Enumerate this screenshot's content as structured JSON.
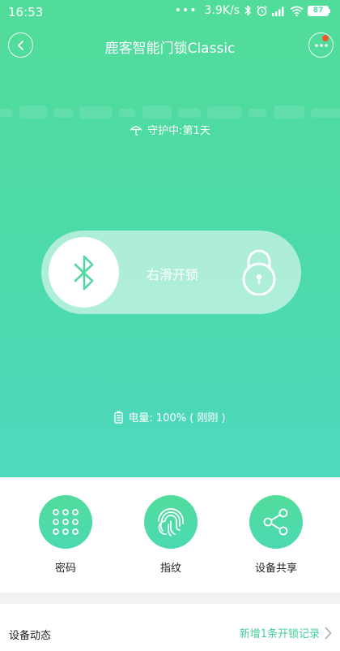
{
  "statusbar": {
    "time": "16:53",
    "dots": "•••",
    "speed": "3.9K/s",
    "battery": "87",
    "icons": [
      "bluetooth-icon",
      "alarm-icon",
      "signal-icon",
      "wifi-icon",
      "battery-icon"
    ]
  },
  "header": {
    "title": "鹿客智能门锁Classic",
    "back_icon": "chevron-left-icon",
    "more_icon": "more-dots-icon",
    "notification_color": "#f05a28"
  },
  "status": {
    "guard_text": "守护中:第1天",
    "guard_icon": "umbrella-icon"
  },
  "unlock": {
    "label": "右滑开锁",
    "knob_icon": "bluetooth-icon",
    "lock_icon": "padlock-icon"
  },
  "power": {
    "text": "电量: 100% ( 刚刚 )",
    "icon": "battery-icon"
  },
  "actions": [
    {
      "label": "密码",
      "icon": "keypad-icon"
    },
    {
      "label": "指纹",
      "icon": "fingerprint-icon"
    },
    {
      "label": "设备共享",
      "icon": "share-icon"
    }
  ],
  "activity": {
    "title": "设备动态",
    "link": "新增1条开锁记录",
    "link_icon": "chevron-right-icon"
  },
  "colors": {
    "accent": "#4fd9a4",
    "link": "#45cf98"
  }
}
